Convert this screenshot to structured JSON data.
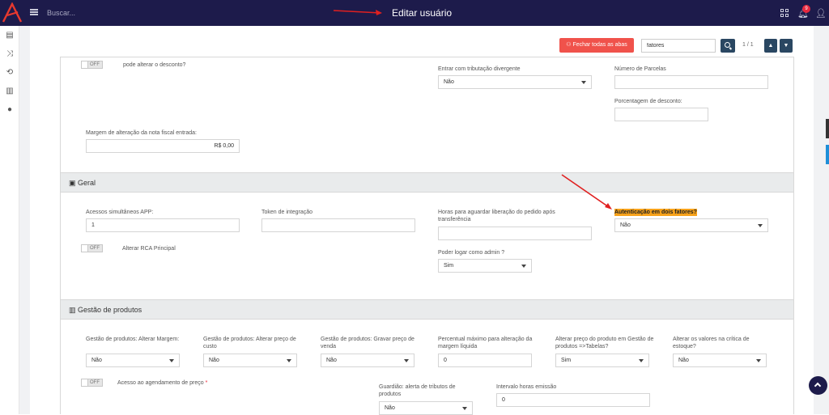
{
  "header": {
    "search_placeholder": "Buscar...",
    "title": "Editar usuário",
    "notification_count": "9"
  },
  "toolbar": {
    "close_tabs_label": "Fechar todas as abas",
    "find_value": "fatores",
    "match_count": "1 / 1"
  },
  "top_section": {
    "discount_toggle_state": "OFF",
    "discount_label": "pode alterar o desconto?",
    "tax_label": "Entrar com tributação divergente",
    "tax_value": "Não",
    "installments_label": "Número de Parcelas",
    "discount_pct_label": "Porcentagem de desconto:",
    "invoice_margin_label": "Margem de alteração da nota fiscal entrada:",
    "invoice_margin_value": "R$ 0,00"
  },
  "geral": {
    "title": "Geral",
    "app_access_label": "Acessos simultâneos APP:",
    "app_access_value": "1",
    "token_label": "Token de integração",
    "hours_label": "Horas para aguardar liberação do pedido após transferência",
    "twofa_label": "Autenticação em dois fatores?",
    "twofa_value": "Não",
    "rca_toggle_state": "OFF",
    "rca_label": "Alterar RCA Principal",
    "admin_label": "Poder logar como admin ?",
    "admin_value": "Sim"
  },
  "produtos": {
    "title": "Gestão de produtos",
    "margin_label": "Gestão de produtos: Alterar Margem:",
    "margin_value": "Não",
    "cost_label": "Gestão de produtos: Alterar preço de custo",
    "cost_value": "Não",
    "sale_label": "Gestão de produtos: Gravar preço de venda",
    "sale_value": "Não",
    "pct_label": "Percentual máximo para alteração da margem líquida",
    "pct_value": "0",
    "tables_label": "Alterar preço do produto em Gestão de produtos =>Tabelas?",
    "tables_value": "Sim",
    "stock_label": "Alterar os valores na crítica de estoque?",
    "stock_value": "Não",
    "schedule_toggle_state": "OFF",
    "schedule_label": "Acesso ao agendamento de preço",
    "required_mark": "*",
    "guardian_label": "Guardião: alerta de tributos de produtos",
    "guardian_value": "Não",
    "interval_label": "Intervalo horas emissão",
    "interval_value": "0"
  },
  "colors": {
    "topbar": "#1d1b4b",
    "accent_red": "#f0524b",
    "nav_blue": "#2a4762",
    "highlight": "#f7a21b"
  }
}
